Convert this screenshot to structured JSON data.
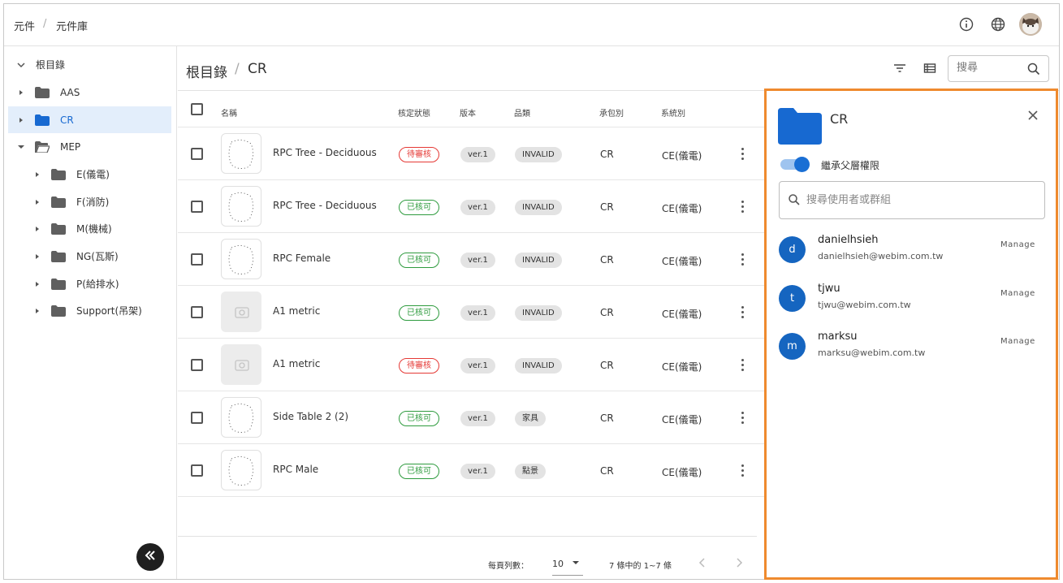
{
  "breadcrumb": [
    "元件",
    "元件庫"
  ],
  "tree": {
    "root": "根目錄",
    "items": [
      {
        "label": "AAS",
        "level": 1,
        "expanded": false,
        "selected": false
      },
      {
        "label": "CR",
        "level": 1,
        "expanded": false,
        "selected": true
      },
      {
        "label": "MEP",
        "level": 1,
        "expanded": true,
        "selected": false
      },
      {
        "label": "E(儀電)",
        "level": 2,
        "expanded": false,
        "selected": false
      },
      {
        "label": "F(消防)",
        "level": 2,
        "expanded": false,
        "selected": false
      },
      {
        "label": "M(機械)",
        "level": 2,
        "expanded": false,
        "selected": false
      },
      {
        "label": "NG(瓦斯)",
        "level": 2,
        "expanded": false,
        "selected": false
      },
      {
        "label": "P(給排水)",
        "level": 2,
        "expanded": false,
        "selected": false
      },
      {
        "label": "Support(吊架)",
        "level": 2,
        "expanded": false,
        "selected": false
      }
    ]
  },
  "main": {
    "path": [
      "根目錄",
      "CR"
    ],
    "search_placeholder": "搜尋"
  },
  "table": {
    "headers": [
      "名稱",
      "核定狀態",
      "版本",
      "品類",
      "承包別",
      "系統別"
    ],
    "rows": [
      {
        "name": "RPC Tree - Deciduous",
        "status": "待審核",
        "status_type": "pending",
        "version": "ver.1",
        "category": "INVALID",
        "contractor": "CR",
        "system": "CE(儀電)",
        "thumb": "sketch"
      },
      {
        "name": "RPC Tree - Deciduous",
        "status": "已核可",
        "status_type": "ok",
        "version": "ver.1",
        "category": "INVALID",
        "contractor": "CR",
        "system": "CE(儀電)",
        "thumb": "sketch"
      },
      {
        "name": "RPC Female",
        "status": "已核可",
        "status_type": "ok",
        "version": "ver.1",
        "category": "INVALID",
        "contractor": "CR",
        "system": "CE(儀電)",
        "thumb": "sketch"
      },
      {
        "name": "A1 metric",
        "status": "已核可",
        "status_type": "ok",
        "version": "ver.1",
        "category": "INVALID",
        "contractor": "CR",
        "system": "CE(儀電)",
        "thumb": "placeholder"
      },
      {
        "name": "A1 metric",
        "status": "待審核",
        "status_type": "pending",
        "version": "ver.1",
        "category": "INVALID",
        "contractor": "CR",
        "system": "CE(儀電)",
        "thumb": "placeholder"
      },
      {
        "name": "Side Table 2 (2)",
        "status": "已核可",
        "status_type": "ok",
        "version": "ver.1",
        "category": "家具",
        "contractor": "CR",
        "system": "CE(儀電)",
        "thumb": "sketch"
      },
      {
        "name": "RPC Male",
        "status": "已核可",
        "status_type": "ok",
        "version": "ver.1",
        "category": "點景",
        "contractor": "CR",
        "system": "CE(儀電)",
        "thumb": "sketch"
      }
    ]
  },
  "pagination": {
    "rows_per_page_label": "每頁列數：",
    "rows_per_page": "10",
    "range_text": "7 條中的 1~7 條"
  },
  "panel": {
    "title": "CR",
    "inherit_label": "繼承父層權限",
    "inherit_on": true,
    "search_placeholder": "搜尋使用者或群組",
    "users": [
      {
        "initial": "d",
        "name": "danielhsieh",
        "email": "danielhsieh@webim.com.tw",
        "action": "Manage"
      },
      {
        "initial": "t",
        "name": "tjwu",
        "email": "tjwu@webim.com.tw",
        "action": "Manage"
      },
      {
        "initial": "m",
        "name": "marksu",
        "email": "marksu@webim.com.tw",
        "action": "Manage"
      }
    ]
  },
  "colors": {
    "accent": "#1769d1",
    "panel_border": "#ef8a2e",
    "pending": "#e53935",
    "approved": "#2e9b3e"
  }
}
